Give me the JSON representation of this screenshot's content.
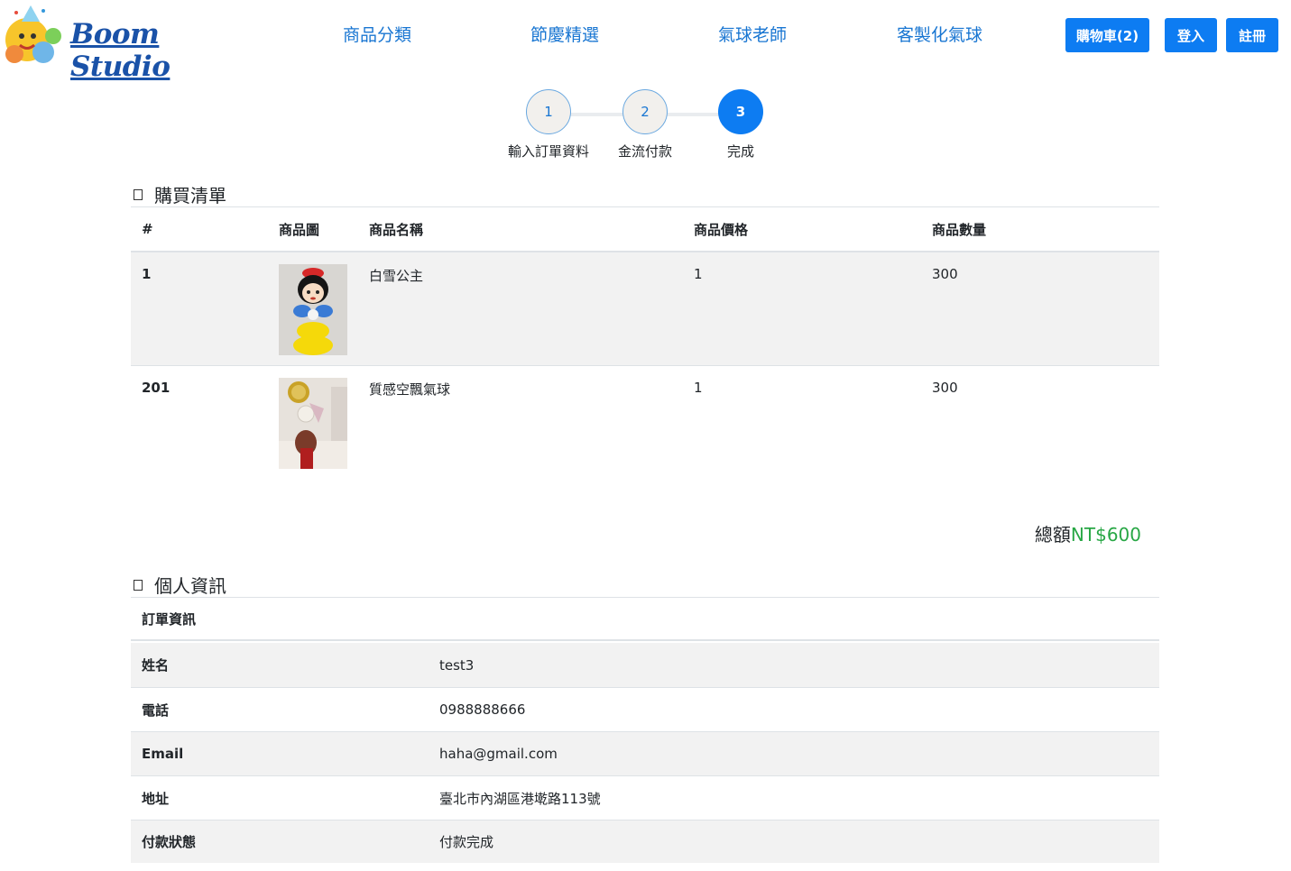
{
  "header": {
    "logo_text": "Boom Studio",
    "nav": [
      "商品分類",
      "節慶精選",
      "氣球老師",
      "客製化氣球"
    ],
    "buttons": {
      "cart": "購物車(2)",
      "login": "登入",
      "register": "註冊"
    }
  },
  "stepper": {
    "steps": [
      {
        "number": "1",
        "label": "輸入訂單資料"
      },
      {
        "number": "2",
        "label": "金流付款"
      },
      {
        "number": "3",
        "label": "完成"
      }
    ],
    "active": 3
  },
  "purchase": {
    "title": "購買清單",
    "headers": [
      "#",
      "商品圖",
      "商品名稱",
      "商品價格",
      "商品數量"
    ],
    "rows": [
      {
        "id": "1",
        "name": "白雪公主",
        "price": "1",
        "qty": "300",
        "image": "snow-white-balloon"
      },
      {
        "id": "201",
        "name": "質感空飄氣球",
        "price": "1",
        "qty": "300",
        "image": "floating-balloon-bouquet"
      }
    ],
    "total_label": "總額",
    "total_amount": "NT$600"
  },
  "personal": {
    "title": "個人資訊",
    "header": "訂單資訊",
    "rows": [
      {
        "key": "姓名",
        "value": "test3"
      },
      {
        "key": "電話",
        "value": "0988888666"
      },
      {
        "key": "Email",
        "value": "haha@gmail.com"
      },
      {
        "key": "地址",
        "value": "臺北市內湖區港墘路113號"
      },
      {
        "key": "付款狀態",
        "value": "付款完成"
      }
    ]
  },
  "colors": {
    "primary": "#0d7cf2",
    "nav": "#1976d2",
    "total": "#28a745",
    "stripe": "#f2f2f2"
  }
}
